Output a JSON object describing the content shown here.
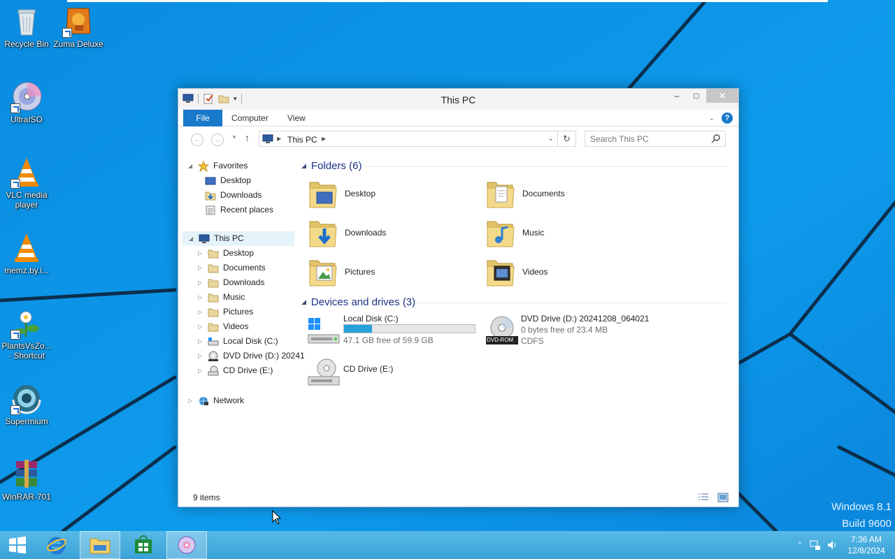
{
  "desktop": {
    "icons": [
      {
        "label": "Recycle Bin",
        "icon": "recycle-bin-icon"
      },
      {
        "label": "Zuma Deluxe",
        "icon": "zuma-icon"
      },
      {
        "label": "UltraISO",
        "icon": "ultraiso-icon"
      },
      {
        "label": "VLC media player",
        "icon": "vlc-icon"
      },
      {
        "label": "memz.by.i...",
        "icon": "vlc-icon"
      },
      {
        "label": "PlantsVsZo... - Shortcut",
        "icon": "plants-vs-zombies-icon"
      },
      {
        "label": "Supermium",
        "icon": "supermium-icon"
      },
      {
        "label": "WinRAR-701",
        "icon": "winrar-icon"
      }
    ],
    "watermark": {
      "line1": "Windows 8.1",
      "line2": "Build 9600"
    }
  },
  "window": {
    "title": "This PC",
    "controls": {
      "minimize": "–",
      "maximize": "□",
      "close": "✕"
    },
    "ribbon": {
      "file": "File",
      "computer": "Computer",
      "view": "View",
      "help": "?"
    },
    "address": {
      "crumb": "This PC"
    },
    "search": {
      "placeholder": "Search This PC"
    },
    "nav": {
      "favorites": {
        "label": "Favorites",
        "items": [
          "Desktop",
          "Downloads",
          "Recent places"
        ]
      },
      "this_pc": {
        "label": "This PC",
        "items": [
          "Desktop",
          "Documents",
          "Downloads",
          "Music",
          "Pictures",
          "Videos",
          "Local Disk (C:)",
          "DVD Drive (D:) 20241",
          "CD Drive (E:)"
        ]
      },
      "network": {
        "label": "Network"
      }
    },
    "folders": {
      "header": "Folders (6)",
      "items": [
        "Desktop",
        "Documents",
        "Downloads",
        "Music",
        "Pictures",
        "Videos"
      ]
    },
    "devices": {
      "header": "Devices and drives (3)",
      "local_disk": {
        "name": "Local Disk (C:)",
        "free": "47.1 GB free of 59.9 GB",
        "used_fraction": 0.214
      },
      "dvd": {
        "name": "DVD Drive (D:) 20241208_064021",
        "free": "0 bytes free of 23.4 MB",
        "fs": "CDFS",
        "badge": "DVD-ROM"
      },
      "cd": {
        "name": "CD Drive (E:)"
      }
    },
    "status": {
      "count": "9 items"
    }
  },
  "taskbar": {
    "clock_time": "7:36 AM",
    "clock_date": "12/8/2024"
  },
  "colors": {
    "accent": "#1979ca",
    "bar_fill": "#26a0da",
    "group_header": "#1e3287"
  }
}
